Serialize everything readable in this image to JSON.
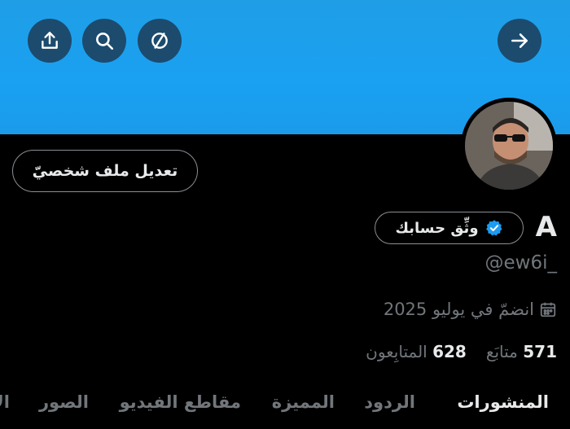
{
  "header": {
    "back_icon": "arrow-right-icon",
    "icons": [
      "share-icon",
      "search-icon",
      "mute-icon"
    ]
  },
  "profile": {
    "name": "A",
    "verify_label": "وثِّق حسابك",
    "handle": "@ew6i_",
    "joined": "انضمّ في يوليو 2025",
    "following_count": "571",
    "following_label": "متابَع",
    "followers_count": "628",
    "followers_label": "المتابِعون",
    "edit_label": "تعديل ملف شخصيّ"
  },
  "tabs": [
    {
      "label": "المنشورات",
      "active": true
    },
    {
      "label": "الردود",
      "active": false
    },
    {
      "label": "المميزة",
      "active": false
    },
    {
      "label": "مقاطع الفيديو",
      "active": false
    },
    {
      "label": "الصور",
      "active": false
    },
    {
      "label": "الإعجابات",
      "active": false
    }
  ],
  "colors": {
    "banner": "#1DA1F2",
    "background": "#000000",
    "verify_badge": "#1D9BF0"
  }
}
